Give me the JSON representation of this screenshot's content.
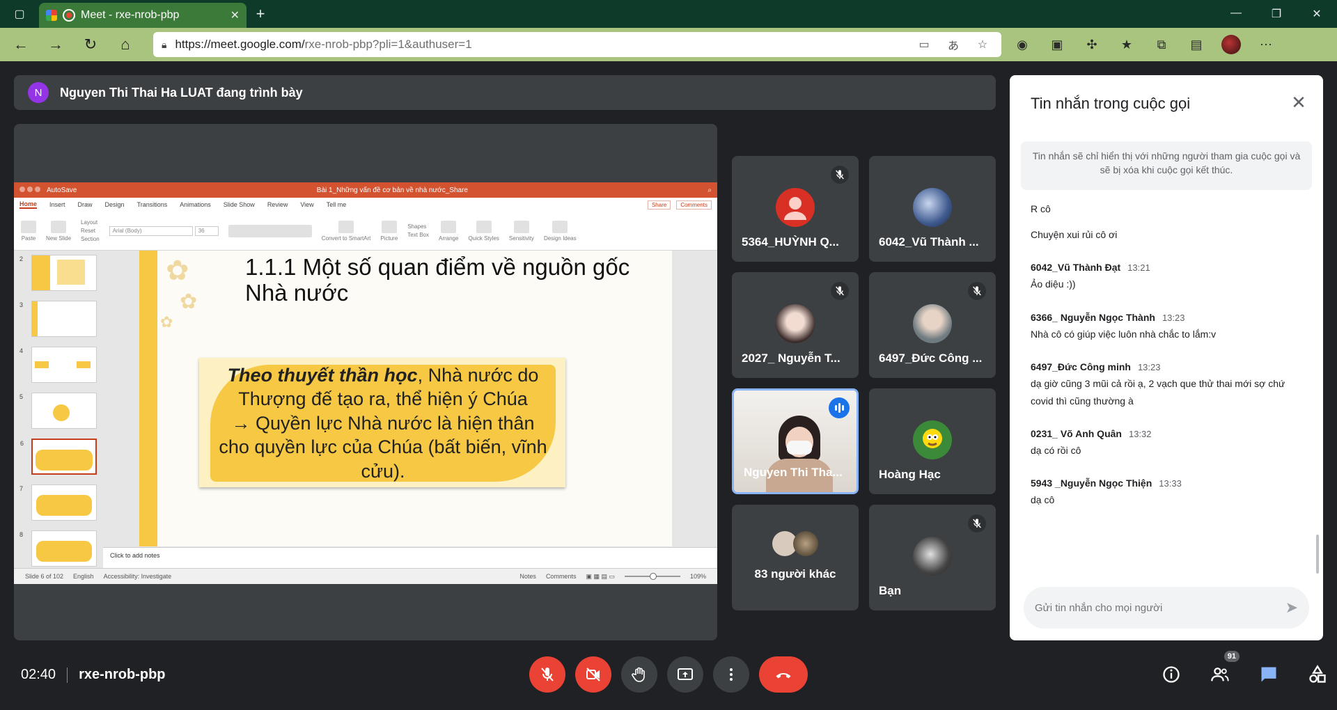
{
  "browser": {
    "tab_title": "Meet - rxe-nrob-pbp",
    "url_host": "https://meet.google.com/",
    "url_path": "rxe-nrob-pbp?pli=1&authuser=1"
  },
  "presenter_bar": {
    "avatar_letter": "N",
    "text": "Nguyen Thi Thai Ha LUAT đang trình bày"
  },
  "ppt": {
    "autosave": "AutoSave",
    "doc_title": "Bài 1_Những vấn đề cơ bản về nhà nước_Share",
    "menu": [
      "Home",
      "Insert",
      "Draw",
      "Design",
      "Transitions",
      "Animations",
      "Slide Show",
      "Review",
      "View",
      "Tell me"
    ],
    "share": "Share",
    "comments": "Comments",
    "ribbon": {
      "paste": "Paste",
      "new_slide": "New Slide",
      "layout": "Layout",
      "reset": "Reset",
      "section": "Section",
      "font": "Arial (Body)",
      "size": "36",
      "convert": "Convert to SmartArt",
      "picture": "Picture",
      "shapes": "Shapes",
      "text_box": "Text Box",
      "arrange": "Arrange",
      "quick_styles": "Quick Styles",
      "sensitivity": "Sensitivity",
      "design_ideas": "Design Ideas"
    },
    "thumb_numbers": [
      "2",
      "3",
      "4",
      "5",
      "6",
      "7",
      "8"
    ],
    "slide": {
      "title": "1.1.1 Một số quan điểm về nguồn gốc Nhà nước",
      "body_bold": "Theo thuyết thần học",
      "body_rest": ", Nhà nước do Thượng đế tạo ra, thể hiện ý Chúa",
      "body_line2": "→ Quyền lực Nhà nước là hiện thân cho quyền lực của Chúa (bất biến, vĩnh cửu)."
    },
    "notes_placeholder": "Click to add notes",
    "status": {
      "slide_of": "Slide 6 of 102",
      "lang": "English",
      "accessibility": "Accessibility: Investigate",
      "notes": "Notes",
      "comments": "Comments",
      "zoom": "109%"
    }
  },
  "participants": [
    {
      "name": "5364_HUỲNH Q...",
      "muted": true,
      "avatar_color": "#d93025"
    },
    {
      "name": "6042_Vũ Thành ...",
      "muted": false,
      "avatar_color": "#4a6fa5"
    },
    {
      "name": "2027_ Nguyễn T...",
      "muted": true,
      "avatar_color": "#8b6f60"
    },
    {
      "name": "6497_Đức Công ...",
      "muted": true,
      "avatar_color": "#7d8a8f"
    },
    {
      "name": "Nguyen Thi Tha...",
      "speaking": true
    },
    {
      "name": "Hoàng Hạc",
      "muted": false,
      "avatar_color": "#3a8a3a"
    },
    {
      "others_label": "83 người khác"
    },
    {
      "name": "Bạn",
      "muted": true,
      "avatar_color": "#555"
    }
  ],
  "chat": {
    "title": "Tin nhắn trong cuộc gọi",
    "notice": "Tin nhắn sẽ chỉ hiển thị với những người tham gia cuộc gọi và sẽ bị xóa khi cuộc gọi kết thúc.",
    "orphan_messages": [
      "R cô",
      "Chuyện xui rủi cô ơi"
    ],
    "messages": [
      {
        "sender": "6042_Vũ Thành Đạt",
        "time": "13:21",
        "lines": [
          "Ảo diệu :))"
        ]
      },
      {
        "sender": "6366_ Nguyễn Ngọc Thành",
        "time": "13:23",
        "lines": [
          "Nhà cô có giúp việc luôn nhà chắc to lắm:v"
        ]
      },
      {
        "sender": "6497_Đức Công minh",
        "time": "13:23",
        "lines": [
          "dạ giờ cũng 3 mũi  cả rồi ạ, 2 vạch que thử thai mới sợ chứ covid thì cũng thường à"
        ]
      },
      {
        "sender": "0231_ Võ Anh Quân",
        "time": "13:32",
        "lines": [
          "dạ có rồi cô"
        ]
      },
      {
        "sender": "5943 _Nguyễn Ngọc Thiện",
        "time": "13:33",
        "lines": [
          "dạ cô"
        ]
      }
    ],
    "compose_placeholder": "Gửi tin nhắn cho mọi người"
  },
  "controls": {
    "time": "02:40",
    "meeting_code": "rxe-nrob-pbp",
    "people_count": "91"
  }
}
